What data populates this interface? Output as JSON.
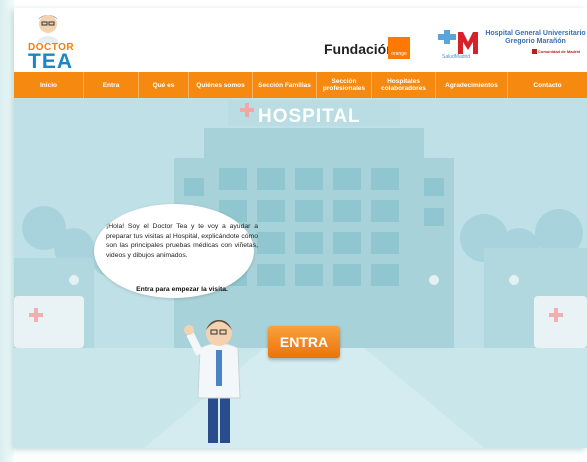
{
  "logo": {
    "line1": "DOCTOR",
    "line2": "TEA"
  },
  "partners": {
    "fundacion": "Fundación",
    "orange": "orange",
    "salud": "SaludMadrid",
    "hospital": "Hospital General Universitario Gregorio Marañón",
    "comunidad": "Comunidad de Madrid"
  },
  "nav": [
    {
      "label": "Inicio"
    },
    {
      "label": "Entra"
    },
    {
      "label": "Qué es"
    },
    {
      "label": "Quiénes somos"
    },
    {
      "label": "Sección Familias"
    },
    {
      "label": "Sección profesionales"
    },
    {
      "label": "Hospitales colaboradores"
    },
    {
      "label": "Agradecimientos"
    },
    {
      "label": "Contacto"
    }
  ],
  "scene": {
    "hospital_sign": "HOSPITAL",
    "bubble_text": "¡Hola! Soy el Doctor Tea y te voy a ayudar a preparar tus visitas al Hospital, explicándote cómo son las principales pruebas médicas con viñetas, videos y dibujos animados.",
    "bubble_cta": "Entra para empezar la visita.",
    "entra_button": "ENTRA"
  },
  "colors": {
    "nav": "#f6890f",
    "sky": "#bfe0e6",
    "button": "#f08a1c",
    "logo_blue": "#1a86c8"
  }
}
